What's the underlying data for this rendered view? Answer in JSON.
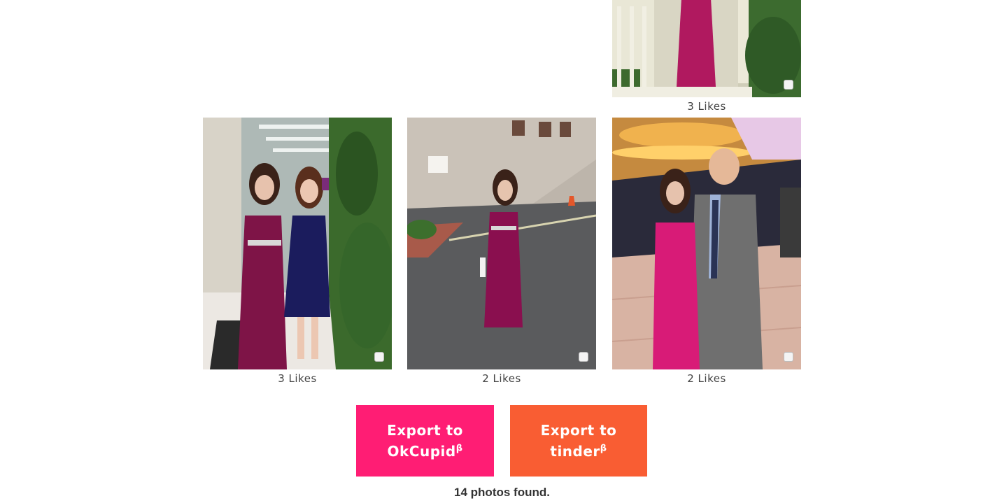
{
  "gallery": {
    "top_photo": {
      "likes": "3 Likes"
    },
    "row": [
      {
        "likes": "3 Likes"
      },
      {
        "likes": "2 Likes"
      },
      {
        "likes": "2 Likes"
      }
    ]
  },
  "export": {
    "okcupid": {
      "line1": "Export to",
      "line2": "OkCupid",
      "beta": "β",
      "color": "#ff1d74"
    },
    "tinder": {
      "line1": "Export to",
      "line2": "tinder",
      "beta": "β",
      "color": "#f95d33"
    }
  },
  "status": {
    "found_text": "14 photos found."
  }
}
